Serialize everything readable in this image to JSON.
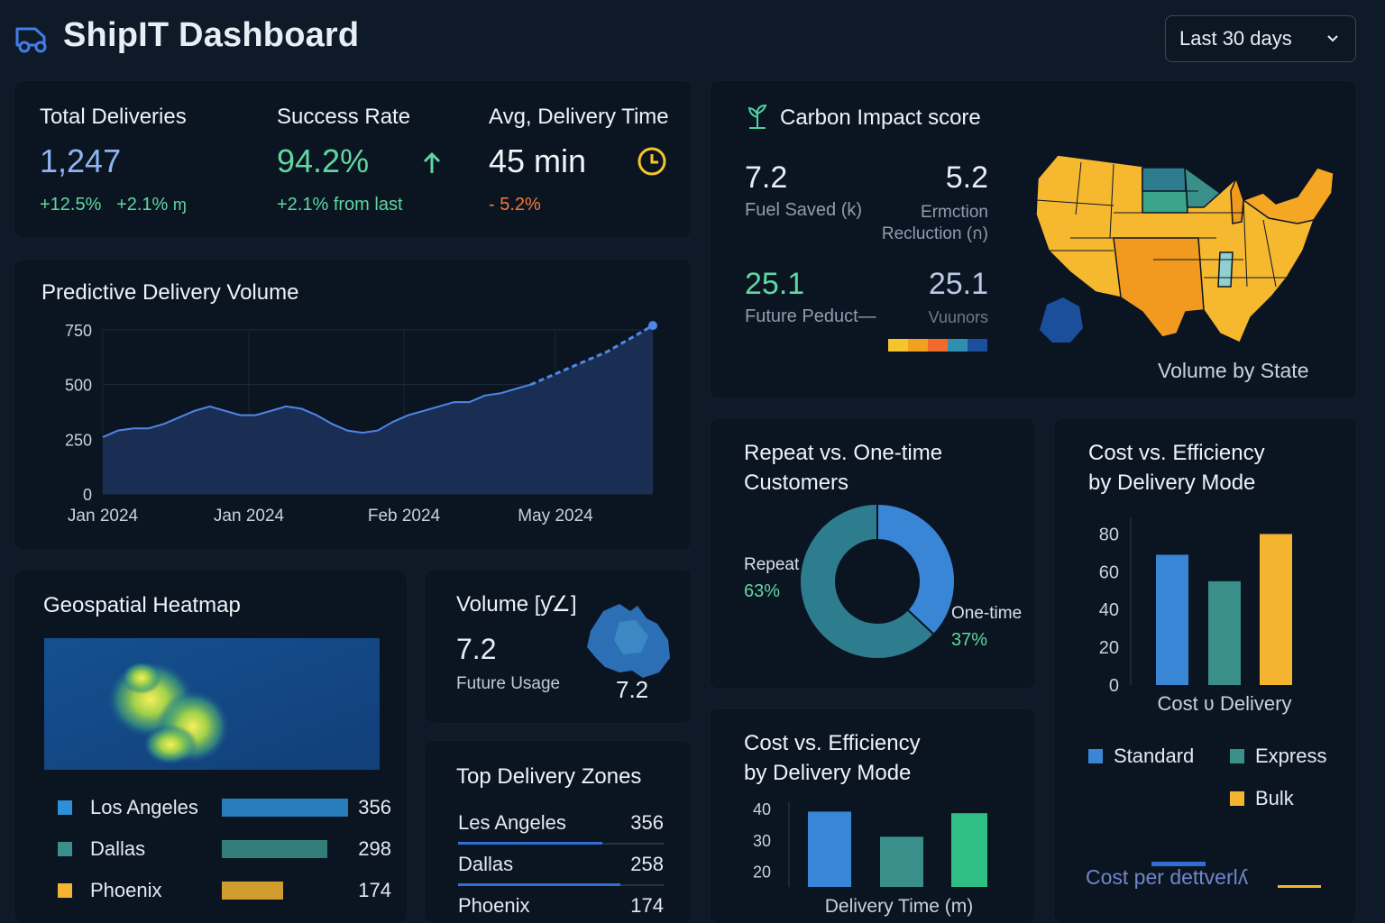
{
  "header": {
    "title": "ShipIT Dashboard",
    "range": "Last 30 days"
  },
  "kpis": {
    "total": {
      "label": "Total Deliveries",
      "value": "1,247",
      "sub1": "+12.5%",
      "sub2": "+2.1%"
    },
    "success": {
      "label": "Success Rate",
      "value": "94.2%",
      "sub": "+2.1% from last"
    },
    "time": {
      "label": "Avg, Delivery Time",
      "value": "45 min",
      "sub": "- 5.2%"
    }
  },
  "carbon": {
    "title": "Carbon Impact score",
    "m1": {
      "value": "7.2",
      "label": "Fuel Saved (k)"
    },
    "m2": {
      "value": "5.2",
      "label_line1": "Ermction",
      "label_line2": "Recluction (ก)"
    },
    "m3": {
      "value": "25.1",
      "label": "Future Peduct—"
    },
    "m4": {
      "value": "25.1",
      "label": "Vuunors"
    },
    "map_label": "Volume by State",
    "colors": {
      "yellow": "#f5b82e",
      "orange": "#f29a1f",
      "teal": "#3aa58a",
      "blue": "#1b5aa8"
    }
  },
  "volume_chart": {
    "title": "Predictive Delivery Volume",
    "chart_data": {
      "type": "area",
      "y_ticks": [
        0,
        250,
        500,
        750
      ],
      "ylim": [
        0,
        750
      ],
      "x_tick_labels": [
        "Jan 2024",
        "Jan 2024",
        "Feb 2024",
        "May 2024"
      ],
      "actual": [
        260,
        290,
        300,
        300,
        320,
        350,
        380,
        400,
        380,
        360,
        360,
        380,
        400,
        390,
        360,
        320,
        290,
        280,
        290,
        330,
        360,
        380,
        400,
        420,
        420,
        450,
        460,
        480,
        500
      ],
      "forecast": [
        500,
        530,
        560,
        590,
        620,
        650,
        690,
        730,
        770
      ],
      "grid": true
    }
  },
  "heatmap": {
    "title": "Geospatial Heatmap",
    "zones": [
      {
        "name": "Los Angeles",
        "value": "356",
        "color": "#2f8fd6"
      },
      {
        "name": "Dallas",
        "value": "298",
        "color": "#3a8f8a"
      },
      {
        "name": "Phoenix",
        "value": "174",
        "color": "#f5b430"
      }
    ],
    "bar_values": [
      356,
      298,
      174
    ]
  },
  "volume_small": {
    "title": "Volume [ƴ∠]",
    "value": "7.2",
    "label": "Future Usage",
    "map_value": "7.2"
  },
  "top_zones": {
    "title": "Top Delivery Zones",
    "rows": [
      {
        "name": "Les Angeles",
        "value": "356"
      },
      {
        "name": "Dallas",
        "value": "258"
      },
      {
        "name": "Phoenix",
        "value": "174"
      }
    ]
  },
  "customers": {
    "title_line1": "Repeat vs. One-time",
    "title_line2": "Customers",
    "chart_data": {
      "type": "pie",
      "slices": [
        {
          "name": "Repeat",
          "value": 63,
          "label": "63%",
          "color": "#2e7d8f"
        },
        {
          "name": "One-time",
          "value": 37,
          "label": "37%",
          "color": "#3a86d6"
        }
      ]
    }
  },
  "cost_mode_small": {
    "title_line1": "Cost vs. Efficiency",
    "title_line2": "by Delivery Mode",
    "chart_data": {
      "type": "bar",
      "xlabel": "Delivery Time (m)",
      "y_ticks": [
        20,
        30,
        40
      ],
      "ylim": [
        15,
        42
      ],
      "values": [
        39,
        31,
        38.5
      ],
      "colors": [
        "#3a86d6",
        "#3a8f8a",
        "#2fbf85"
      ]
    }
  },
  "cost_mode_large": {
    "title_line1": "Cost vs.  Efficiency",
    "title_line2": "by Delivery Mode",
    "chart_data": {
      "type": "bar",
      "xlabel": "Cost ʋ Delivery",
      "y_ticks": [
        0,
        20,
        40,
        60,
        80
      ],
      "ylim": [
        0,
        85
      ],
      "series": [
        {
          "name": "Standard",
          "value": 69,
          "color": "#3a86d6"
        },
        {
          "name": "Express",
          "value": 55,
          "color": "#3a8f8a"
        },
        {
          "name": "Bulk",
          "value": 80,
          "color": "#f5b430"
        }
      ]
    },
    "footer": "Cost per dettverlʎ"
  }
}
